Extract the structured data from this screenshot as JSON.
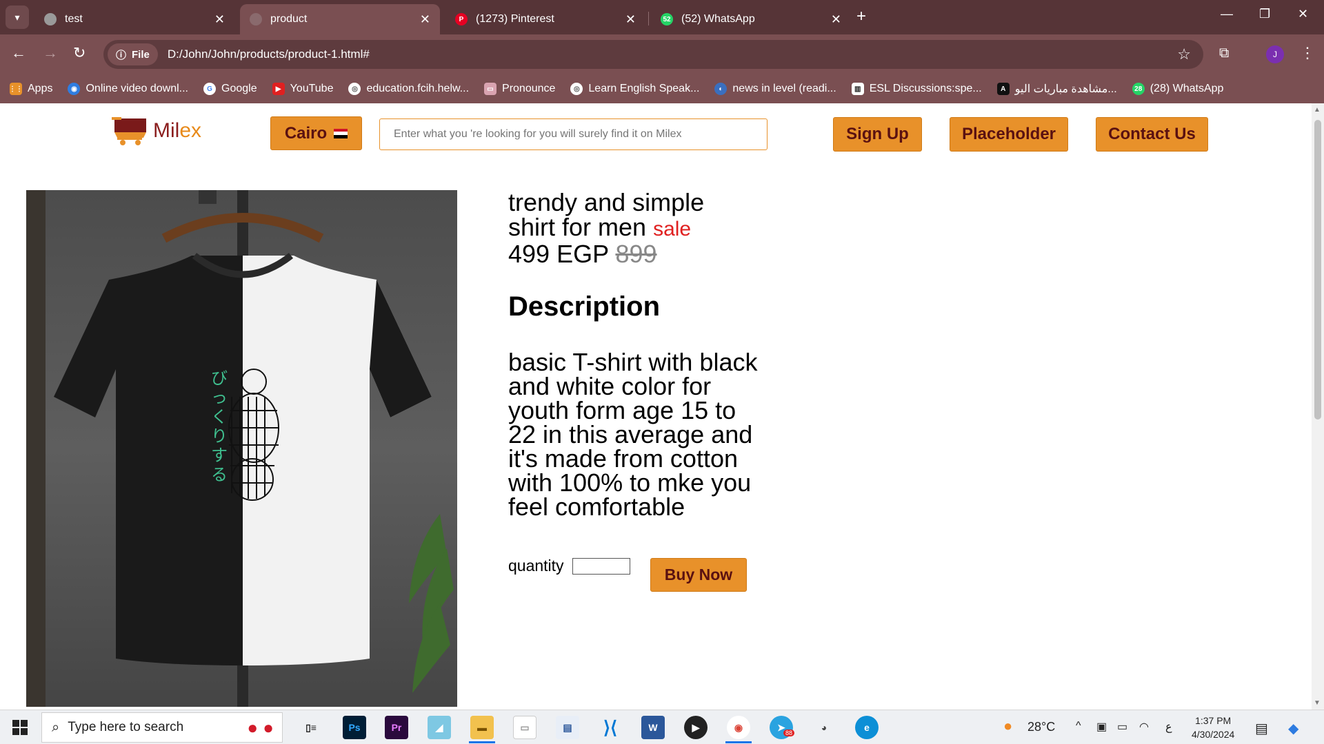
{
  "browser": {
    "tabs": [
      {
        "title": "test",
        "icon": "globe-icon",
        "active": false
      },
      {
        "title": "product",
        "icon": "globe-icon",
        "active": true
      },
      {
        "title": "(1273) Pinterest",
        "icon": "pinterest-icon",
        "active": false
      },
      {
        "title": "(52) WhatsApp",
        "icon": "whatsapp-icon",
        "active": false
      }
    ],
    "url_chip": "File",
    "url": "D:/John/John/products/product-1.html#",
    "profile_initial": "J",
    "bookmarks": [
      {
        "label": "Apps",
        "icon": "apps-grid-icon",
        "color": "#e8912a"
      },
      {
        "label": "Online video downl...",
        "icon": "download-icon",
        "color": "#2f7de1"
      },
      {
        "label": "Google",
        "icon": "google-icon",
        "color": "#ffffff"
      },
      {
        "label": "YouTube",
        "icon": "youtube-icon",
        "color": "#e02020"
      },
      {
        "label": "education.fcih.helw...",
        "icon": "globe-icon",
        "color": "#ffffff"
      },
      {
        "label": "Pronounce",
        "icon": "pronounce-icon",
        "color": "#d9a3b0"
      },
      {
        "label": "Learn English Speak...",
        "icon": "globe-icon",
        "color": "#ffffff"
      },
      {
        "label": "news in level (readi...",
        "icon": "news-icon",
        "color": "#3a6fbf"
      },
      {
        "label": "ESL Discussions:spe...",
        "icon": "esl-icon",
        "color": "#ffffff"
      },
      {
        "label": "مشاهدة مباريات اليو...",
        "icon": "sports-icon",
        "color": "#111111"
      },
      {
        "label": "(28) WhatsApp",
        "icon": "whatsapp-icon",
        "color": "#25d366"
      }
    ]
  },
  "site": {
    "logo_main": "Mil",
    "logo_accent": "ex",
    "city_label": "Cairo",
    "search_placeholder": "Enter what you 're looking for you will surely find it on Milex",
    "nav": {
      "signup": "Sign Up",
      "placeholder": "Placeholder",
      "contact": "Contact Us"
    }
  },
  "product": {
    "title_line1": "trendy and simple",
    "title_line2": "shirt for men",
    "sale_label": "sale",
    "price": "499 EGP",
    "old_price": "899",
    "description_heading": "Description",
    "description": "basic T-shirt with black and white color for youth form age 15 to 22 in this average and it's made from cotton with 100% to mke you feel comfortable",
    "quantity_label": "quantity",
    "quantity_value": "",
    "buy_label": "Buy Now",
    "shirt_print_text": "びっくりする"
  },
  "taskbar": {
    "search_placeholder": "Type here to search",
    "weather": "28°C",
    "time": "1:37 PM",
    "date": "4/30/2024",
    "telegram_badge": "88",
    "lang": "ع"
  },
  "colors": {
    "chrome_dark": "#563437",
    "chrome": "#7a4f52",
    "accent_orange": "#e8912a",
    "accent_maroon": "#5a1111",
    "sale_red": "#e02020"
  }
}
